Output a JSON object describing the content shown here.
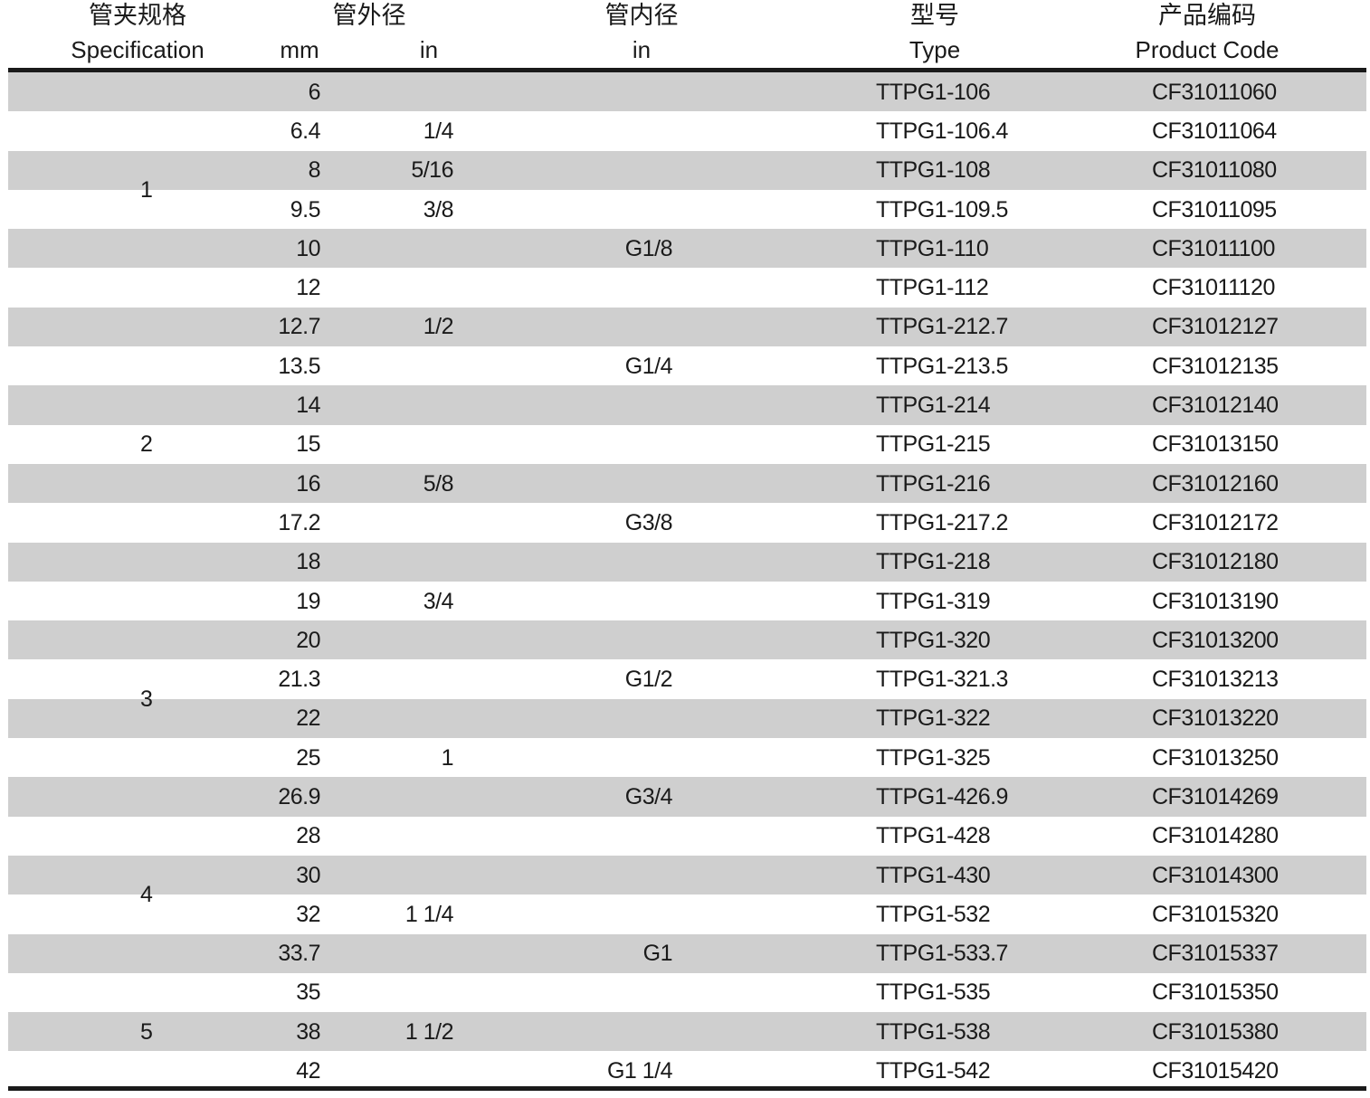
{
  "headers": {
    "spec": {
      "zh": "管夹规格",
      "en": "Specification"
    },
    "od": {
      "zh": "管外径",
      "mm": "mm",
      "in": "in"
    },
    "id": {
      "zh": "管内径",
      "in": "in"
    },
    "type": {
      "zh": "型号",
      "en": "Type"
    },
    "code": {
      "zh": "产品编码",
      "en": "Product Code"
    }
  },
  "spec_labels": [
    "1",
    "2",
    "3",
    "4",
    "5"
  ],
  "rows": [
    {
      "mm": "6",
      "in": "",
      "id": "",
      "type": "TTPG1-106",
      "code": "CF31011060"
    },
    {
      "mm": "6.4",
      "in": "1/4",
      "id": "",
      "type": "TTPG1-106.4",
      "code": "CF31011064"
    },
    {
      "mm": "8",
      "in": "5/16",
      "id": "",
      "type": "TTPG1-108",
      "code": "CF31011080"
    },
    {
      "mm": "9.5",
      "in": "3/8",
      "id": "",
      "type": "TTPG1-109.5",
      "code": "CF31011095"
    },
    {
      "mm": "10",
      "in": "",
      "id": "G1/8",
      "type": "TTPG1-110",
      "code": "CF31011100"
    },
    {
      "mm": "12",
      "in": "",
      "id": "",
      "type": "TTPG1-112",
      "code": "CF31011120"
    },
    {
      "mm": "12.7",
      "in": "1/2",
      "id": "",
      "type": "TTPG1-212.7",
      "code": "CF31012127"
    },
    {
      "mm": "13.5",
      "in": "",
      "id": "G1/4",
      "type": "TTPG1-213.5",
      "code": "CF31012135"
    },
    {
      "mm": "14",
      "in": "",
      "id": "",
      "type": "TTPG1-214",
      "code": "CF31012140"
    },
    {
      "mm": "15",
      "in": "",
      "id": "",
      "type": "TTPG1-215",
      "code": "CF31013150"
    },
    {
      "mm": "16",
      "in": "5/8",
      "id": "",
      "type": "TTPG1-216",
      "code": "CF31012160"
    },
    {
      "mm": "17.2",
      "in": "",
      "id": "G3/8",
      "type": "TTPG1-217.2",
      "code": "CF31012172"
    },
    {
      "mm": "18",
      "in": "",
      "id": "",
      "type": "TTPG1-218",
      "code": "CF31012180"
    },
    {
      "mm": "19",
      "in": "3/4",
      "id": "",
      "type": "TTPG1-319",
      "code": "CF31013190"
    },
    {
      "mm": "20",
      "in": "",
      "id": "",
      "type": "TTPG1-320",
      "code": "CF31013200"
    },
    {
      "mm": "21.3",
      "in": "",
      "id": "G1/2",
      "type": "TTPG1-321.3",
      "code": "CF31013213"
    },
    {
      "mm": "22",
      "in": "",
      "id": "",
      "type": "TTPG1-322",
      "code": "CF31013220"
    },
    {
      "mm": "25",
      "in": "1",
      "id": "",
      "type": "TTPG1-325",
      "code": "CF31013250"
    },
    {
      "mm": "26.9",
      "in": "",
      "id": "G3/4",
      "type": "TTPG1-426.9",
      "code": "CF31014269"
    },
    {
      "mm": "28",
      "in": "",
      "id": "",
      "type": "TTPG1-428",
      "code": "CF31014280"
    },
    {
      "mm": "30",
      "in": "",
      "id": "",
      "type": "TTPG1-430",
      "code": "CF31014300"
    },
    {
      "mm": "32",
      "in": "1 1/4",
      "id": "",
      "type": "TTPG1-532",
      "code": "CF31015320"
    },
    {
      "mm": "33.7",
      "in": "",
      "id": "G1",
      "type": "TTPG1-533.7",
      "code": "CF31015337"
    },
    {
      "mm": "35",
      "in": "",
      "id": "",
      "type": "TTPG1-535",
      "code": "CF31015350"
    },
    {
      "mm": "38",
      "in": "1 1/2",
      "id": "",
      "type": "TTPG1-538",
      "code": "CF31015380"
    },
    {
      "mm": "42",
      "in": "",
      "id": "G1 1/4",
      "type": "TTPG1-542",
      "code": "CF31015420"
    }
  ],
  "colors": {
    "shade": "#cfcfcf",
    "rule": "#1a1a1a",
    "text": "#1a1a1a"
  }
}
